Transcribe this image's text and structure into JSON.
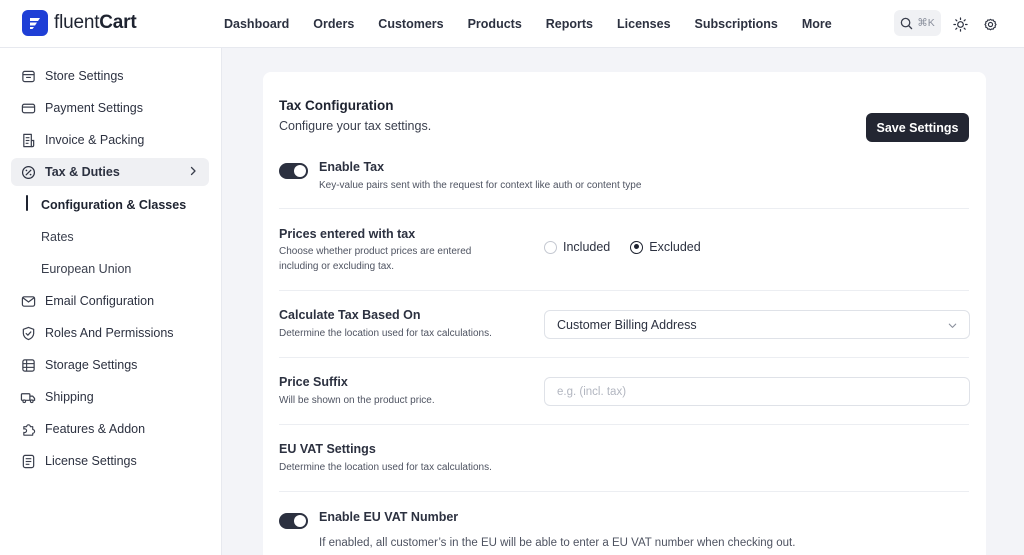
{
  "brand": {
    "name_light": "fluent",
    "name_bold": "Cart",
    "accent": "#1f3fd6"
  },
  "nav": {
    "items": [
      "Dashboard",
      "Orders",
      "Customers",
      "Products",
      "Reports",
      "Licenses",
      "Subscriptions",
      "More"
    ],
    "search_shortcut": "⌘K",
    "icons": [
      "search-icon",
      "sun-icon",
      "gear-icon"
    ]
  },
  "sidebar": {
    "items": [
      {
        "label": "Store Settings",
        "icon": "store-icon"
      },
      {
        "label": "Payment Settings",
        "icon": "credit-card-icon"
      },
      {
        "label": "Invoice & Packing",
        "icon": "invoice-icon"
      },
      {
        "label": "Tax & Duties",
        "icon": "percent-icon",
        "active": true
      },
      {
        "label": "Email Configuration",
        "icon": "mail-icon"
      },
      {
        "label": "Roles And Permissions",
        "icon": "shield-icon"
      },
      {
        "label": "Storage Settings",
        "icon": "storage-icon"
      },
      {
        "label": "Shipping",
        "icon": "truck-icon"
      },
      {
        "label": "Features & Addon",
        "icon": "puzzle-icon"
      },
      {
        "label": "License Settings",
        "icon": "license-icon"
      }
    ],
    "sub_items": [
      "Configuration & Classes",
      "Rates",
      "European Union"
    ]
  },
  "main": {
    "title": "Tax Configuration",
    "subtitle": "Configure your tax settings.",
    "save_label": "Save Settings",
    "enable_tax": {
      "title": "Enable Tax",
      "desc": "Key-value pairs sent with the request for context like auth or content type",
      "enabled": true
    },
    "prices_with_tax": {
      "title": "Prices entered with tax",
      "desc_line1": "Choose whether product prices are entered",
      "desc_line2": "including or excluding tax.",
      "options": [
        "Included",
        "Excluded"
      ],
      "selected": "Excluded"
    },
    "calculate_based_on": {
      "title": "Calculate Tax Based On",
      "desc": "Determine the location used for tax calculations.",
      "value": "Customer Billing Address"
    },
    "price_suffix": {
      "title": "Price Suffix",
      "desc": "Will be shown on the product price.",
      "placeholder": "e.g. (incl. tax)",
      "value": ""
    },
    "eu_vat": {
      "title": "EU VAT Settings",
      "desc": "Determine the location used for tax calculations."
    },
    "eu_vat_number": {
      "title": "Enable EU VAT Number",
      "desc": "If enabled, all customer’s in the EU will be able to enter a EU VAT number when checking out.",
      "enabled": true
    }
  }
}
